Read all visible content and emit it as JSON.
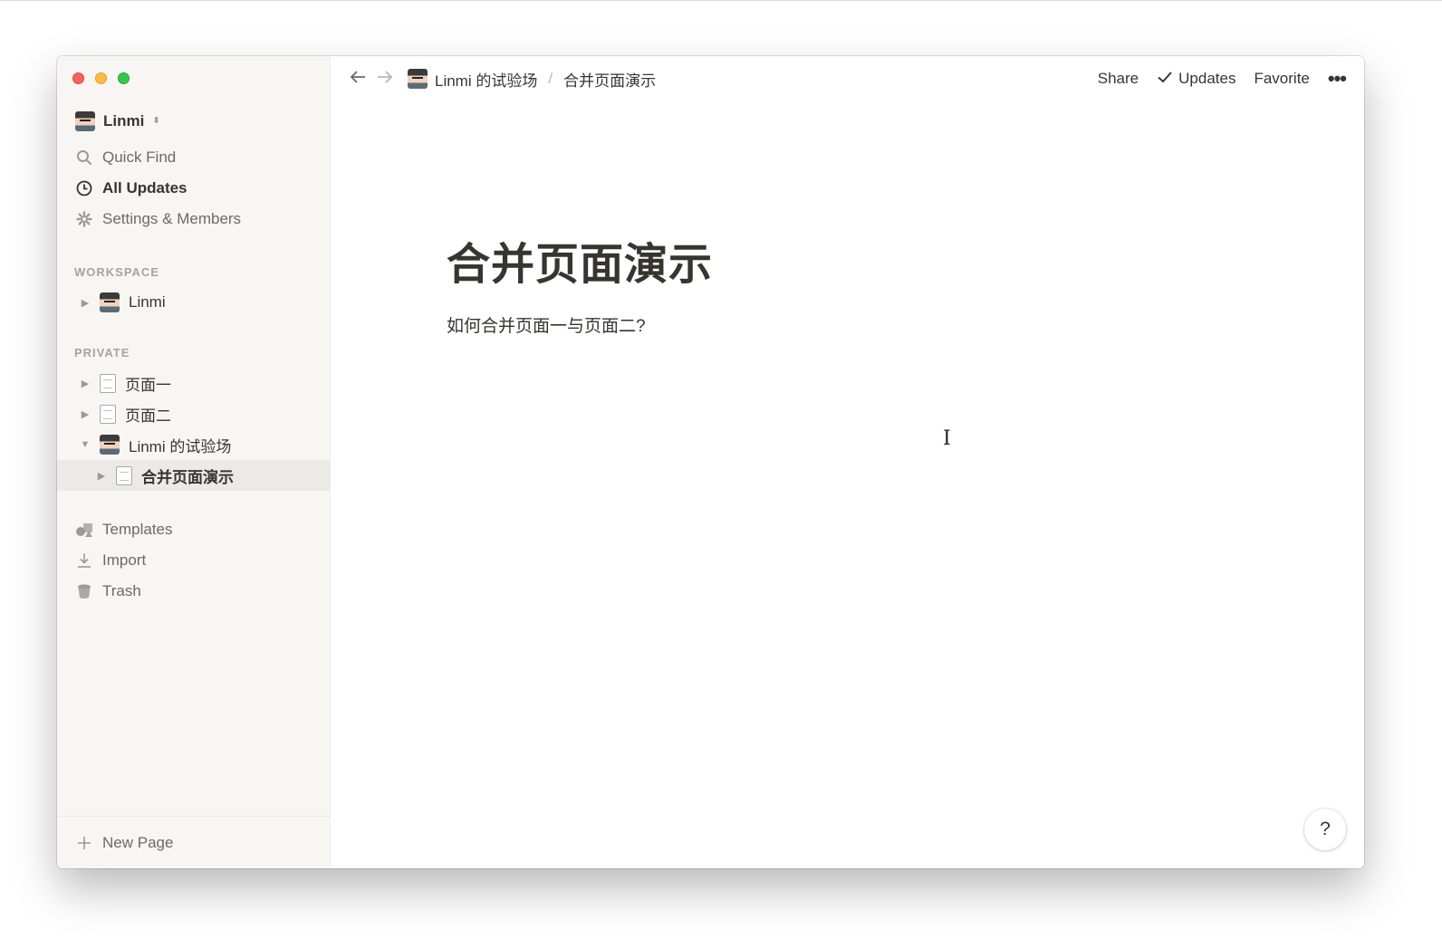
{
  "workspace": {
    "name": "Linmi"
  },
  "sidebar": {
    "menu": [
      {
        "label": "Quick Find",
        "icon": "search-icon"
      },
      {
        "label": "All Updates",
        "icon": "clock-icon"
      },
      {
        "label": "Settings & Members",
        "icon": "gear-icon"
      }
    ],
    "workspace_label": "WORKSPACE",
    "workspace_items": [
      {
        "label": "Linmi"
      }
    ],
    "private_label": "PRIVATE",
    "private_items": [
      {
        "label": "页面一"
      },
      {
        "label": "页面二"
      },
      {
        "label": "Linmi 的试验场"
      },
      {
        "label": "合并页面演示"
      }
    ],
    "bottom_menu": [
      {
        "label": "Templates",
        "icon": "templates-icon"
      },
      {
        "label": "Import",
        "icon": "download-icon"
      },
      {
        "label": "Trash",
        "icon": "trash-icon"
      }
    ],
    "new_page": "New Page"
  },
  "topbar": {
    "breadcrumb": [
      "Linmi 的试验场",
      "/",
      "合并页面演示"
    ],
    "share": "Share",
    "updates": "Updates",
    "favorite": "Favorite",
    "more": "•••"
  },
  "page": {
    "title": "合并页面演示",
    "body": "如何合并页面一与页面二?"
  },
  "help": "?"
}
